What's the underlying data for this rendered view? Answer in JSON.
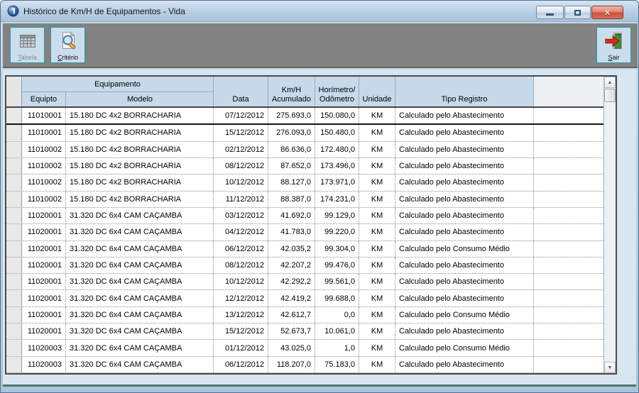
{
  "window": {
    "title": "Histórico de Km/H de Equipamentos - Vida"
  },
  "toolbar": {
    "tabela_label": "Tabela",
    "criterio_label": "Critério",
    "sair_label": "Sair"
  },
  "grid": {
    "headers": {
      "group_equipamento": "Equipamento",
      "equipto": "Equipto",
      "modelo": "Modelo",
      "data": "Data",
      "kmh_line1": "Km/H",
      "kmh_line2": "Acumulado",
      "horimetro_line1": "Horímetro/",
      "horimetro_line2": "Odômetro",
      "unidade": "Unidade",
      "tipo_registro": "Tipo Registro"
    },
    "rows": [
      {
        "equipto": "11010001",
        "modelo": "15.180 DC 4x2 BORRACHARIA",
        "data": "07/12/2012",
        "kmh": "275.693,0",
        "horimetro": "150.080,0",
        "unidade": "KM",
        "tipo": "Calculado pelo Abastecimento",
        "current": true
      },
      {
        "equipto": "11010001",
        "modelo": "15.180 DC 4x2 BORRACHARIA",
        "data": "15/12/2012",
        "kmh": "276.093,0",
        "horimetro": "150.480,0",
        "unidade": "KM",
        "tipo": "Calculado pelo Abastecimento"
      },
      {
        "equipto": "11010002",
        "modelo": "15.180 DC 4x2 BORRACHARIA",
        "data": "02/12/2012",
        "kmh": "86.636,0",
        "horimetro": "172.480,0",
        "unidade": "KM",
        "tipo": "Calculado pelo Abastecimento"
      },
      {
        "equipto": "11010002",
        "modelo": "15.180 DC 4x2 BORRACHARIA",
        "data": "08/12/2012",
        "kmh": "87.652,0",
        "horimetro": "173.496,0",
        "unidade": "KM",
        "tipo": "Calculado pelo Abastecimento"
      },
      {
        "equipto": "11010002",
        "modelo": "15.180 DC 4x2 BORRACHARIA",
        "data": "10/12/2012",
        "kmh": "88.127,0",
        "horimetro": "173.971,0",
        "unidade": "KM",
        "tipo": "Calculado pelo Abastecimento"
      },
      {
        "equipto": "11010002",
        "modelo": "15.180 DC 4x2 BORRACHARIA",
        "data": "11/12/2012",
        "kmh": "88.387,0",
        "horimetro": "174.231,0",
        "unidade": "KM",
        "tipo": "Calculado pelo Abastecimento"
      },
      {
        "equipto": "11020001",
        "modelo": "31.320 DC 6x4 CAM CAÇAMBA",
        "data": "03/12/2012",
        "kmh": "41.692,0",
        "horimetro": "99.129,0",
        "unidade": "KM",
        "tipo": "Calculado pelo Abastecimento"
      },
      {
        "equipto": "11020001",
        "modelo": "31.320 DC 6x4 CAM CAÇAMBA",
        "data": "04/12/2012",
        "kmh": "41.783,0",
        "horimetro": "99.220,0",
        "unidade": "KM",
        "tipo": "Calculado pelo Abastecimento"
      },
      {
        "equipto": "11020001",
        "modelo": "31.320 DC 6x4 CAM CAÇAMBA",
        "data": "06/12/2012",
        "kmh": "42.035,2",
        "horimetro": "99.304,0",
        "unidade": "KM",
        "tipo": "Calculado pelo Consumo Médio"
      },
      {
        "equipto": "11020001",
        "modelo": "31.320 DC 6x4 CAM CAÇAMBA",
        "data": "08/12/2012",
        "kmh": "42.207,2",
        "horimetro": "99.476,0",
        "unidade": "KM",
        "tipo": "Calculado pelo Abastecimento"
      },
      {
        "equipto": "11020001",
        "modelo": "31.320 DC 6x4 CAM CAÇAMBA",
        "data": "10/12/2012",
        "kmh": "42.292,2",
        "horimetro": "99.561,0",
        "unidade": "KM",
        "tipo": "Calculado pelo Abastecimento"
      },
      {
        "equipto": "11020001",
        "modelo": "31.320 DC 6x4 CAM CAÇAMBA",
        "data": "12/12/2012",
        "kmh": "42.419,2",
        "horimetro": "99.688,0",
        "unidade": "KM",
        "tipo": "Calculado pelo Abastecimento"
      },
      {
        "equipto": "11020001",
        "modelo": "31.320 DC 6x4 CAM CAÇAMBA",
        "data": "13/12/2012",
        "kmh": "42.612,7",
        "horimetro": "0,0",
        "unidade": "KM",
        "tipo": "Calculado pelo Consumo Médio"
      },
      {
        "equipto": "11020001",
        "modelo": "31.320 DC 6x4 CAM CAÇAMBA",
        "data": "15/12/2012",
        "kmh": "52.673,7",
        "horimetro": "10.061,0",
        "unidade": "KM",
        "tipo": "Calculado pelo Abastecimento"
      },
      {
        "equipto": "11020003",
        "modelo": "31.320 DC 6x4 CAM CAÇAMBA",
        "data": "01/12/2012",
        "kmh": "43.025,0",
        "horimetro": "1,0",
        "unidade": "KM",
        "tipo": "Calculado pelo Consumo Médio"
      },
      {
        "equipto": "11020003",
        "modelo": "31.320 DC 6x4 CAM CAÇAMBA",
        "data": "06/12/2012",
        "kmh": "118.207,0",
        "horimetro": "75.183,0",
        "unidade": "KM",
        "tipo": "Calculado pelo Abastecimento"
      }
    ]
  },
  "colors": {
    "titlebar": "#bcd2e6",
    "toolbar_gray": "#828282",
    "button_face": "#cadded",
    "button_border": "#2a9ba1",
    "grid_header": "#c6daeb",
    "close_red": "#c94f38"
  }
}
